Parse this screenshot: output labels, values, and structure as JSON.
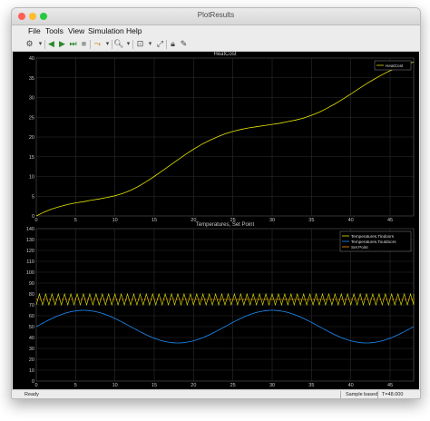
{
  "window": {
    "title": "PlotResults"
  },
  "menu": [
    "File",
    "Tools",
    "View",
    "Simulation",
    "Help"
  ],
  "toolbar": {
    "icons": [
      "settings-icon",
      "back-icon",
      "play-icon",
      "step-forward-icon",
      "stop-icon",
      "cursor-icon",
      "zoom-icon",
      "fit-icon",
      "expand-icon",
      "lock-icon",
      "edit-icon"
    ]
  },
  "status": {
    "ready": "Ready",
    "sample": "Sample based",
    "time": "T=48.000"
  },
  "colors": {
    "plot_bg": "#000000",
    "axes_bg": "#000000",
    "grid": "#2c2c2c",
    "heatcost": "#e6e600",
    "tindoors": "#e6e600",
    "toutdoors": "#1e90ff",
    "setpoint": "#ff9900"
  },
  "chart_data": [
    {
      "type": "line",
      "title": "HeatCost",
      "xlim": [
        0,
        48
      ],
      "ylim": [
        0,
        40
      ],
      "xticks": [
        "0",
        "5",
        "10",
        "15",
        "20",
        "25",
        "30",
        "35",
        "40",
        "45"
      ],
      "yticks": [
        "0",
        "5",
        "10",
        "15",
        "20",
        "25",
        "30",
        "35",
        "40"
      ],
      "legend": {
        "placement": "top-right",
        "entries": [
          "HeatCost"
        ]
      },
      "series": [
        {
          "name": "HeatCost",
          "x": [
            0,
            1,
            2,
            3,
            4,
            5,
            6,
            7,
            8,
            9,
            10,
            11,
            12,
            13,
            14,
            15,
            16,
            17,
            18,
            19,
            20,
            21,
            22,
            23,
            24,
            25,
            26,
            27,
            28,
            29,
            30,
            31,
            32,
            33,
            34,
            35,
            36,
            37,
            38,
            39,
            40,
            41,
            42,
            43,
            44,
            45,
            46,
            47,
            48
          ],
          "y": [
            0,
            1.0,
            1.8,
            2.4,
            2.9,
            3.3,
            3.6,
            4.0,
            4.3,
            4.7,
            5.1,
            5.7,
            6.5,
            7.5,
            8.7,
            10.0,
            11.4,
            12.8,
            14.2,
            15.6,
            16.9,
            18.1,
            19.1,
            20.0,
            20.8,
            21.4,
            21.9,
            22.3,
            22.6,
            22.9,
            23.2,
            23.5,
            23.9,
            24.3,
            24.8,
            25.5,
            26.3,
            27.3,
            28.4,
            29.6,
            30.9,
            32.2,
            33.5,
            34.7,
            35.8,
            36.8,
            37.6,
            38.3,
            39.0
          ]
        }
      ]
    },
    {
      "type": "line",
      "title": "Temperatures, Set Point",
      "xlim": [
        0,
        48
      ],
      "ylim": [
        0,
        140
      ],
      "xticks": [
        "0",
        "5",
        "10",
        "15",
        "20",
        "25",
        "30",
        "35",
        "40",
        "45"
      ],
      "yticks": [
        "0",
        "10",
        "20",
        "30",
        "40",
        "50",
        "60",
        "70",
        "80",
        "90",
        "100",
        "110",
        "120",
        "130",
        "140"
      ],
      "legend": {
        "placement": "top-right",
        "entries": [
          "Temperatures.Tindoors",
          "Temperatures.Toutdoors",
          "Set Point"
        ]
      },
      "series": [
        {
          "name": "Temperatures.Tindoors",
          "pattern": "sawtooth",
          "low": 70,
          "high": 80,
          "period_hours": 0.8
        },
        {
          "name": "Temperatures.Toutdoors",
          "pattern": "sinusoid",
          "mean": 50,
          "amplitude": 15,
          "period_hours": 24,
          "peak_hour": 6
        },
        {
          "name": "Set Point",
          "pattern": "constant",
          "value": 75
        }
      ]
    }
  ]
}
